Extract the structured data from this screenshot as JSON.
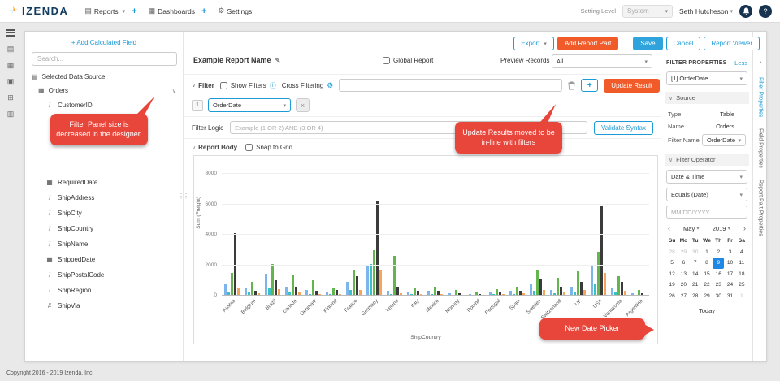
{
  "icons": {
    "caret_down": "▾",
    "chevron_down": "∨",
    "chevron_left": "‹",
    "chevron_right": "›",
    "gear": "⚙",
    "pencil": "✎",
    "info": "ⓘ",
    "close": "×",
    "plus": "+",
    "grid": "▤",
    "table": "▦",
    "dots": "⋮⋮"
  },
  "navbar": {
    "brand": "IZENDA",
    "reports": "Reports",
    "dashboards": "Dashboards",
    "settings": "Settings",
    "setting_level_label": "Setting Level",
    "setting_level_value": "System",
    "user_name": "Seth Hutcheson",
    "help_glyph": "?"
  },
  "left_panel": {
    "add_calculated_field": "+ Add Calculated Field",
    "search_placeholder": "Search...",
    "data_source_label": "Selected Data Source",
    "table_name": "Orders",
    "fields": [
      {
        "name": "CustomerID",
        "type": "text"
      },
      {
        "name": "RequiredDate",
        "type": "date"
      },
      {
        "name": "ShipAddress",
        "type": "text"
      },
      {
        "name": "ShipCity",
        "type": "text"
      },
      {
        "name": "ShipCountry",
        "type": "text"
      },
      {
        "name": "ShipName",
        "type": "text"
      },
      {
        "name": "ShippedDate",
        "type": "date"
      },
      {
        "name": "ShipPostalCode",
        "type": "text"
      },
      {
        "name": "ShipRegion",
        "type": "text"
      },
      {
        "name": "ShipVia",
        "type": "number"
      }
    ]
  },
  "toolbar": {
    "export": "Export",
    "add_report_part": "Add Report Part",
    "save": "Save",
    "cancel": "Cancel",
    "report_viewer": "Report Viewer"
  },
  "report_header": {
    "name": "Example Report Name",
    "global_report": "Global Report",
    "preview_records": "Preview Records",
    "preview_value": "All"
  },
  "filter_bar": {
    "filter_label": "Filter",
    "show_filters": "Show Filters",
    "cross_filtering": "Cross Filtering",
    "update_result": "Update Result",
    "row_number": "1",
    "row_field": "OrderDate",
    "filter_logic_label": "Filter Logic",
    "filter_logic_placeholder": "Example (1 OR 2) AND (3 OR 4)",
    "validate_syntax": "Validate Syntax"
  },
  "report_body": {
    "label": "Report Body",
    "snap_to_grid": "Snap to Grid"
  },
  "chart_data": {
    "type": "bar",
    "title": "",
    "xlabel": "ShipCountry",
    "ylabel": "Sum (Freight)",
    "ylim": [
      0,
      8000
    ],
    "yticks": [
      0,
      2000,
      4000,
      6000,
      8000
    ],
    "grid": true,
    "legend": "none",
    "categories": [
      "Austria",
      "Belgium",
      "Brazil",
      "Canada",
      "Denmark",
      "Finland",
      "France",
      "Germany",
      "Ireland",
      "Italy",
      "Mexico",
      "Norway",
      "Poland",
      "Portugal",
      "Spain",
      "Sweden",
      "Switzerland",
      "UK",
      "USA",
      "Venezuela",
      "Argentina"
    ],
    "series": [
      {
        "name": "series-1",
        "color": "#7cb5ec",
        "values": [
          750,
          500,
          1450,
          600,
          350,
          250,
          900,
          2000,
          300,
          250,
          300,
          150,
          100,
          200,
          300,
          800,
          350,
          600,
          2000,
          500,
          150
        ]
      },
      {
        "name": "series-2",
        "color": "#3bc0c3",
        "values": [
          250,
          200,
          500,
          200,
          100,
          100,
          400,
          2100,
          100,
          100,
          100,
          50,
          50,
          100,
          100,
          300,
          150,
          250,
          800,
          200,
          50
        ]
      },
      {
        "name": "series-3",
        "color": "#63b54e",
        "values": [
          1500,
          900,
          2100,
          1400,
          1000,
          500,
          1700,
          3000,
          2600,
          500,
          600,
          350,
          250,
          450,
          600,
          1700,
          1200,
          1600,
          2900,
          1300,
          350
        ]
      },
      {
        "name": "series-4",
        "color": "#3b3b3b",
        "values": [
          4100,
          300,
          1000,
          600,
          300,
          350,
          1300,
          6200,
          600,
          300,
          300,
          150,
          100,
          250,
          300,
          1100,
          600,
          900,
          5900,
          900,
          150
        ]
      },
      {
        "name": "series-5",
        "color": "#f5a45c",
        "values": [
          550,
          150,
          450,
          250,
          100,
          100,
          400,
          1700,
          150,
          100,
          100,
          50,
          50,
          100,
          150,
          350,
          200,
          400,
          1500,
          300,
          50
        ]
      }
    ]
  },
  "properties_panel": {
    "title": "FILTER PROPERTIES",
    "less": "Less",
    "filter_selector": "[1] OrderDate",
    "source_section": "Source",
    "type_label": "Type",
    "type_value": "Table",
    "name_label": "Name",
    "name_value": "Orders",
    "filter_name_label": "Filter Name",
    "filter_name_value": "OrderDate",
    "operator_section": "Filter Operator",
    "operator_category": "Date & Time",
    "operator_value": "Equals (Date)",
    "date_placeholder": "MM/DD/YYYY",
    "calendar": {
      "month": "May",
      "year": "2019",
      "weekdays": [
        "Su",
        "Mo",
        "Tu",
        "We",
        "Th",
        "Fr",
        "Sa"
      ],
      "weeks": [
        [
          {
            "d": "28",
            "muted": true
          },
          {
            "d": "29",
            "muted": true
          },
          {
            "d": "30",
            "muted": true
          },
          {
            "d": "1"
          },
          {
            "d": "2"
          },
          {
            "d": "3"
          },
          {
            "d": "4"
          }
        ],
        [
          {
            "d": "5"
          },
          {
            "d": "6"
          },
          {
            "d": "7"
          },
          {
            "d": "8"
          },
          {
            "d": "9",
            "selected": true
          },
          {
            "d": "10"
          },
          {
            "d": "11"
          }
        ],
        [
          {
            "d": "12"
          },
          {
            "d": "13"
          },
          {
            "d": "14"
          },
          {
            "d": "15"
          },
          {
            "d": "16"
          },
          {
            "d": "17"
          },
          {
            "d": "18"
          }
        ],
        [
          {
            "d": "19"
          },
          {
            "d": "20"
          },
          {
            "d": "21"
          },
          {
            "d": "22"
          },
          {
            "d": "23"
          },
          {
            "d": "24"
          },
          {
            "d": "25"
          }
        ],
        [
          {
            "d": "26"
          },
          {
            "d": "27"
          },
          {
            "d": "28"
          },
          {
            "d": "29"
          },
          {
            "d": "30"
          },
          {
            "d": "31"
          },
          {
            "d": "1",
            "muted": true
          }
        ]
      ],
      "today": "Today"
    }
  },
  "side_tabs": [
    "Filter Properties",
    "Field Properties",
    "Report Part Properties"
  ],
  "callouts": {
    "filter_panel": "Filter Panel size is decreased in the designer.",
    "update_results": "Update Results moved to be in-line with filters",
    "date_picker": "New Date Picker"
  },
  "footer": "Copyright 2016 - 2019 Izenda, Inc.",
  "colors": {
    "accent_blue": "#1e9bd7",
    "orange": "#f15b2a",
    "callout_red": "#e8463b",
    "selected_day_blue": "#1e88e5"
  }
}
